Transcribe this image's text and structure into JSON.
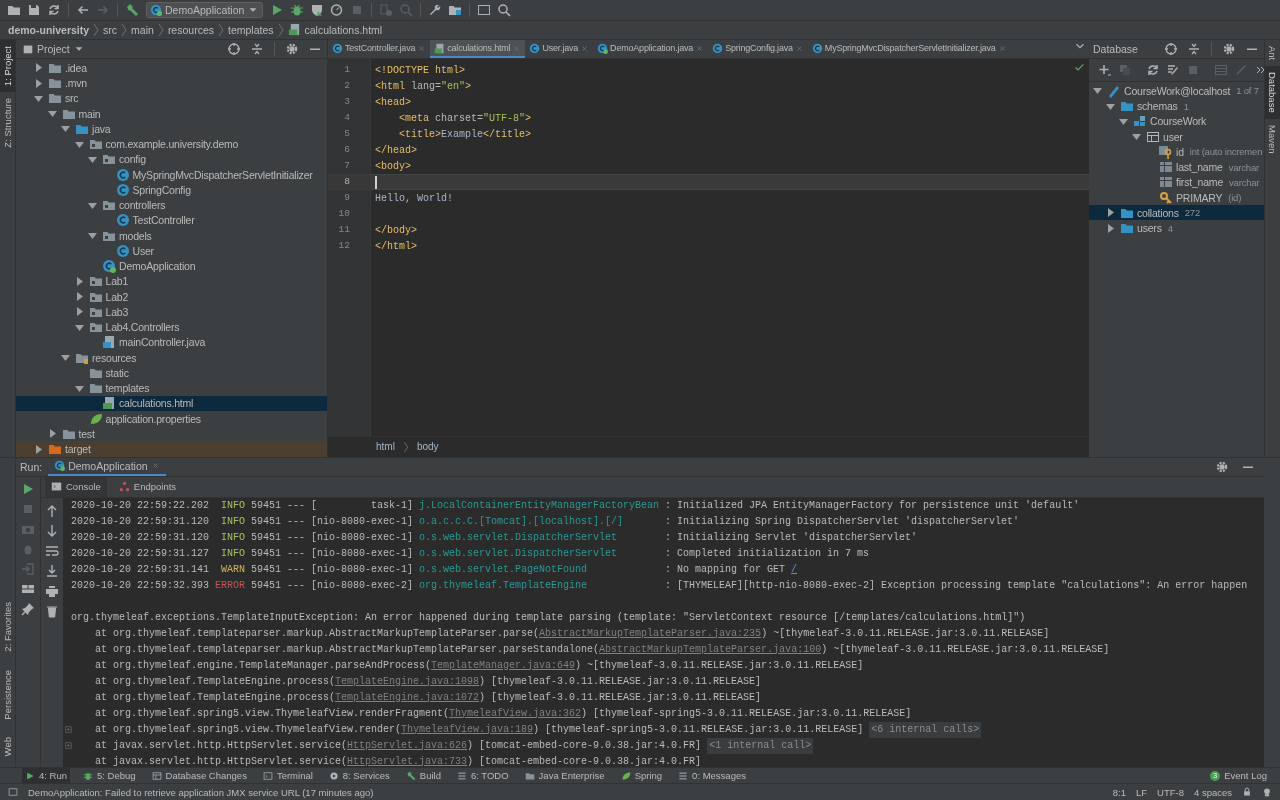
{
  "toolbar": {
    "run_config": "DemoApplication"
  },
  "breadcrumb": [
    {
      "label": "demo-university",
      "kind": "project"
    },
    {
      "label": "src",
      "kind": "dir"
    },
    {
      "label": "main",
      "kind": "dir"
    },
    {
      "label": "resources",
      "kind": "dir"
    },
    {
      "label": "templates",
      "kind": "dir"
    },
    {
      "label": "calculations.html",
      "kind": "html"
    }
  ],
  "left_stripe": [
    {
      "label": "1: Project",
      "selected": true
    },
    {
      "label": "Z: Structure",
      "selected": false
    }
  ],
  "left_stripe_bottom": [
    {
      "label": "2: Favorites",
      "selected": false
    },
    {
      "label": "Persistence",
      "selected": false
    },
    {
      "label": "Web",
      "selected": false
    }
  ],
  "right_stripe": [
    {
      "label": "Ant",
      "selected": false
    },
    {
      "label": "Database",
      "selected": true
    },
    {
      "label": "Maven",
      "selected": false
    }
  ],
  "project": {
    "title": "Project",
    "tree": [
      {
        "label": ".idea",
        "kind": "folder",
        "expanded": false,
        "selected": false
      },
      {
        "label": ".mvn",
        "kind": "folder",
        "expanded": false,
        "selected": false
      },
      {
        "label": "src",
        "kind": "folder",
        "expanded": true,
        "selected": false,
        "children": [
          {
            "label": "main",
            "kind": "folder",
            "expanded": true,
            "selected": false,
            "children": [
              {
                "label": "java",
                "kind": "src-folder",
                "expanded": true,
                "selected": false,
                "children": [
                  {
                    "label": "com.example.university.demo",
                    "kind": "package",
                    "expanded": true,
                    "selected": false,
                    "children": [
                      {
                        "label": "config",
                        "kind": "package",
                        "expanded": true,
                        "selected": false,
                        "children": [
                          {
                            "label": "MySpringMvcDispatcherServletInitializer",
                            "kind": "class",
                            "selected": false
                          },
                          {
                            "label": "SpringConfig",
                            "kind": "class",
                            "selected": false
                          }
                        ]
                      },
                      {
                        "label": "controllers",
                        "kind": "package",
                        "expanded": true,
                        "selected": false,
                        "children": [
                          {
                            "label": "TestController",
                            "kind": "class",
                            "selected": false
                          }
                        ]
                      },
                      {
                        "label": "models",
                        "kind": "package",
                        "expanded": true,
                        "selected": false,
                        "children": [
                          {
                            "label": "User",
                            "kind": "class",
                            "selected": false
                          }
                        ]
                      },
                      {
                        "label": "DemoApplication",
                        "kind": "spring-class",
                        "selected": false
                      }
                    ]
                  },
                  {
                    "label": "Lab1",
                    "kind": "package",
                    "expanded": false,
                    "selected": false
                  },
                  {
                    "label": "Lab2",
                    "kind": "package",
                    "expanded": false,
                    "selected": false
                  },
                  {
                    "label": "Lab3",
                    "kind": "package",
                    "expanded": false,
                    "selected": false
                  },
                  {
                    "label": "Lab4.Controllers",
                    "kind": "package",
                    "expanded": true,
                    "selected": false,
                    "children": [
                      {
                        "label": "mainController.java",
                        "kind": "java-file",
                        "selected": false
                      }
                    ]
                  }
                ]
              },
              {
                "label": "resources",
                "kind": "resources",
                "expanded": true,
                "selected": false,
                "children": [
                  {
                    "label": "static",
                    "kind": "folder",
                    "selected": false
                  },
                  {
                    "label": "templates",
                    "kind": "folder",
                    "expanded": true,
                    "selected": false,
                    "children": [
                      {
                        "label": "calculations.html",
                        "kind": "html",
                        "selected": true
                      }
                    ]
                  },
                  {
                    "label": "application.properties",
                    "kind": "properties",
                    "selected": false
                  }
                ]
              }
            ]
          },
          {
            "label": "test",
            "kind": "folder",
            "expanded": false,
            "selected": false
          }
        ]
      },
      {
        "label": "target",
        "kind": "excluded",
        "expanded": false,
        "selected": false
      }
    ]
  },
  "editor": {
    "tabs": [
      {
        "label": "TestController.java",
        "kind": "class",
        "selected": false
      },
      {
        "label": "calculations.html",
        "kind": "html",
        "selected": true
      },
      {
        "label": "User.java",
        "kind": "class",
        "selected": false
      },
      {
        "label": "DemoApplication.java",
        "kind": "spring-class",
        "selected": false
      },
      {
        "label": "SpringConfig.java",
        "kind": "class",
        "selected": false
      },
      {
        "label": "MySpringMvcDispatcherServletInitializer.java",
        "kind": "class",
        "selected": false
      }
    ],
    "lines": [
      {
        "no": "1",
        "current": false,
        "tokens": [
          {
            "t": "<!DOCTYPE html>",
            "kind": "tag"
          }
        ]
      },
      {
        "no": "2",
        "current": false,
        "tokens": [
          {
            "t": "<html",
            "kind": "tag"
          },
          {
            "t": " lang=",
            "kind": "attr"
          },
          {
            "t": "\"en\"",
            "kind": "value"
          },
          {
            "t": ">",
            "kind": "tag"
          }
        ]
      },
      {
        "no": "3",
        "current": false,
        "tokens": [
          {
            "t": "<head>",
            "kind": "tag"
          }
        ]
      },
      {
        "no": "4",
        "current": false,
        "tokens": [
          {
            "t": "    <meta",
            "kind": "tag"
          },
          {
            "t": " charset=",
            "kind": "attr"
          },
          {
            "t": "\"UTF-8\"",
            "kind": "value"
          },
          {
            "t": ">",
            "kind": "tag"
          }
        ]
      },
      {
        "no": "5",
        "current": false,
        "tokens": [
          {
            "t": "    <title>",
            "kind": "tag"
          },
          {
            "t": "Example",
            "kind": "text"
          },
          {
            "t": "</title>",
            "kind": "tag"
          }
        ]
      },
      {
        "no": "6",
        "current": false,
        "tokens": [
          {
            "t": "</head>",
            "kind": "tag"
          }
        ]
      },
      {
        "no": "7",
        "current": false,
        "tokens": [
          {
            "t": "<body>",
            "kind": "tag"
          }
        ]
      },
      {
        "no": "8",
        "current": true
      },
      {
        "no": "9",
        "current": false,
        "tokens": [
          {
            "t": "Hello, World!",
            "kind": "text"
          }
        ]
      },
      {
        "no": "10",
        "current": false
      },
      {
        "no": "11",
        "current": false,
        "tokens": [
          {
            "t": "</body>",
            "kind": "tag"
          }
        ]
      },
      {
        "no": "12",
        "current": false,
        "tokens": [
          {
            "t": "</html>",
            "kind": "tag"
          }
        ]
      }
    ],
    "breadcrumb": [
      "html",
      "body"
    ]
  },
  "database": {
    "title": "Database",
    "tree": [
      {
        "label": "CourseWork@localhost",
        "hint": "1 of 7",
        "kind": "datasource",
        "expanded": true,
        "selected": false,
        "children": [
          {
            "label": "schemas",
            "hint": "1",
            "kind": "db-folder",
            "expanded": true,
            "selected": false,
            "children": [
              {
                "label": "CourseWork",
                "kind": "schema",
                "expanded": true,
                "selected": false,
                "children": [
                  {
                    "label": "user",
                    "kind": "table",
                    "expanded": true,
                    "selected": false,
                    "children": [
                      {
                        "label": "id",
                        "hint": "int (auto incremen",
                        "kind": "key-column",
                        "selected": false
                      },
                      {
                        "label": "last_name",
                        "hint": "varchar",
                        "kind": "column",
                        "selected": false
                      },
                      {
                        "label": "first_name",
                        "hint": "varchar",
                        "kind": "column",
                        "selected": false
                      },
                      {
                        "label": "PRIMARY",
                        "hint": "(id)",
                        "kind": "key",
                        "selected": false
                      }
                    ]
                  }
                ]
              }
            ]
          },
          {
            "label": "collations",
            "hint": "272",
            "kind": "db-folder",
            "expanded": false,
            "selected": true
          },
          {
            "label": "users",
            "hint": "4",
            "kind": "db-folder",
            "expanded": false,
            "selected": false
          }
        ]
      }
    ]
  },
  "run": {
    "label": "Run:",
    "tab": "DemoApplication",
    "subtabs": [
      {
        "label": "Console",
        "selected": true
      },
      {
        "label": "Endpoints",
        "selected": false
      }
    ],
    "log": [
      {
        "time": "2020-10-20 22:59:22.202",
        "level": "INFO",
        "pid": "59451",
        "sep": "---",
        "thread": "[         task-1]",
        "logger": "j.LocalContainerEntityManagerFactoryBean",
        "message": ": Initialized JPA EntityManagerFactory for persistence unit 'default'"
      },
      {
        "time": "2020-10-20 22:59:31.120",
        "level": "INFO",
        "pid": "59451",
        "sep": "---",
        "thread": "[nio-8080-exec-1]",
        "logger": "o.a.c.c.C.[Tomcat].[localhost].[/]",
        "message": ": Initializing Spring DispatcherServlet 'dispatcherServlet'"
      },
      {
        "time": "2020-10-20 22:59:31.120",
        "level": "INFO",
        "pid": "59451",
        "sep": "---",
        "thread": "[nio-8080-exec-1]",
        "logger": "o.s.web.servlet.DispatcherServlet",
        "message": ": Initializing Servlet 'dispatcherServlet'"
      },
      {
        "time": "2020-10-20 22:59:31.127",
        "level": "INFO",
        "pid": "59451",
        "sep": "---",
        "thread": "[nio-8080-exec-1]",
        "logger": "o.s.web.servlet.DispatcherServlet",
        "message": ": Completed initialization in 7 ms"
      },
      {
        "time": "2020-10-20 22:59:31.141",
        "level": "WARN",
        "pid": "59451",
        "sep": "---",
        "thread": "[nio-8080-exec-1]",
        "logger": "o.s.web.servlet.PageNotFound",
        "message": ": No mapping for GET ",
        "link": "/"
      },
      {
        "time": "2020-10-20 22:59:32.393",
        "level": "ERROR",
        "pid": "59451",
        "sep": "---",
        "thread": "[nio-8080-exec-2]",
        "logger": "org.thymeleaf.TemplateEngine",
        "message": ": [THYMELEAF][http-nio-8080-exec-2] Exception processing template \"calculations\": An error happen"
      }
    ],
    "exception": "org.thymeleaf.exceptions.TemplateInputException: An error happened during template parsing (template: \"ServletContext resource [/templates/calculations.html]\")",
    "trace": [
      {
        "text": "at org.thymeleaf.templateparser.markup.AbstractMarkupTemplateParser.parse(",
        "link": "AbstractMarkupTemplateParser.java:235",
        "suffix": ") ~[thymeleaf-3.0.11.RELEASE.jar:3.0.11.RELEASE]",
        "fold": false
      },
      {
        "text": "at org.thymeleaf.templateparser.markup.AbstractMarkupTemplateParser.parseStandalone(",
        "link": "AbstractMarkupTemplateParser.java:100",
        "suffix": ") ~[thymeleaf-3.0.11.RELEASE.jar:3.0.11.RELEASE]",
        "fold": false
      },
      {
        "text": "at org.thymeleaf.engine.TemplateManager.parseAndProcess(",
        "link": "TemplateManager.java:649",
        "suffix": ") ~[thymeleaf-3.0.11.RELEASE.jar:3.0.11.RELEASE]",
        "fold": false
      },
      {
        "text": "at org.thymeleaf.TemplateEngine.process(",
        "link": "TemplateEngine.java:1098",
        "suffix": ") [thymeleaf-3.0.11.RELEASE.jar:3.0.11.RELEASE]",
        "fold": false
      },
      {
        "text": "at org.thymeleaf.TemplateEngine.process(",
        "link": "TemplateEngine.java:1072",
        "suffix": ") [thymeleaf-3.0.11.RELEASE.jar:3.0.11.RELEASE]",
        "fold": false
      },
      {
        "text": "at org.thymeleaf.spring5.view.ThymeleafView.renderFragment(",
        "link": "ThymeleafView.java:362",
        "suffix": ") [thymeleaf-spring5-3.0.11.RELEASE.jar:3.0.11.RELEASE]",
        "fold": false
      },
      {
        "text": "at org.thymeleaf.spring5.view.ThymeleafView.render(",
        "link": "ThymeleafView.java:189",
        "suffix": ") [thymeleaf-spring5-3.0.11.RELEASE.jar:3.0.11.RELEASE]",
        "note": "<6 internal calls>",
        "fold": true
      },
      {
        "text": "at javax.servlet.http.HttpServlet.service(",
        "link": "HttpServlet.java:626",
        "suffix": ") [tomcat-embed-core-9.0.38.jar:4.0.FR]",
        "note": "<1 internal call>",
        "fold": true
      },
      {
        "text": "at javax.servlet.http.HttpServlet.service(",
        "link": "HttpServlet.java:733",
        "suffix": ") [tomcat-embed-core-9.0.38.jar:4.0.FR]",
        "fold": false
      }
    ]
  },
  "tool_windows": [
    {
      "label": "4: Run",
      "kind": "run",
      "selected": true
    },
    {
      "label": "5: Debug",
      "kind": "debug",
      "selected": false
    },
    {
      "label": "Database Changes",
      "kind": "table",
      "selected": false
    },
    {
      "label": "Terminal",
      "kind": "terminal",
      "selected": false
    },
    {
      "label": "8: Services",
      "kind": "services",
      "selected": false
    },
    {
      "label": "Build",
      "kind": "hammer",
      "selected": false
    },
    {
      "label": "6: TODO",
      "kind": "list",
      "selected": false
    },
    {
      "label": "Java Enterprise",
      "kind": "folder",
      "selected": false
    },
    {
      "label": "Spring",
      "kind": "properties",
      "selected": false
    },
    {
      "label": "0: Messages",
      "kind": "list",
      "selected": false
    }
  ],
  "event_log": {
    "label": "Event Log",
    "count": "3"
  },
  "status": {
    "message": "DemoApplication: Failed to retrieve application JMX service URL (17 minutes ago)",
    "items": [
      "8:1",
      "LF",
      "UTF-8",
      "4 spaces"
    ]
  }
}
